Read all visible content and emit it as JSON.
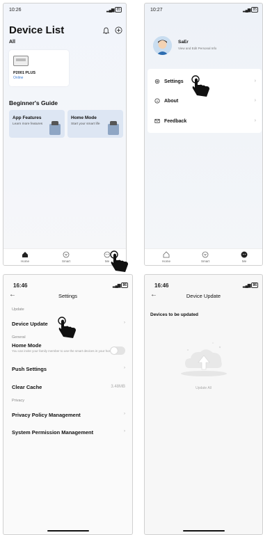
{
  "screen1": {
    "time": "10:26",
    "battery": "85",
    "title": "Device List",
    "subtitle": "All",
    "device": {
      "name": "P2001 PLUS",
      "status": "Online"
    },
    "guide_title": "Beginner's Guide",
    "guides": [
      {
        "title": "App Features",
        "subtitle": "Learn more features"
      },
      {
        "title": "Home Mode",
        "subtitle": "Start your smart life"
      }
    ],
    "tabs": [
      "Home",
      "Smart",
      "Me"
    ]
  },
  "screen2": {
    "time": "10:27",
    "battery": "85",
    "user_name": "SaEr",
    "user_info": "View and Edit Personal Info",
    "menu": [
      "Settings",
      "About",
      "Feedback"
    ],
    "tabs": [
      "Home",
      "Smart",
      "Me"
    ]
  },
  "screen3": {
    "time": "16:46",
    "battery": "86",
    "title": "Settings",
    "section_update": "Update",
    "device_update": "Device Update",
    "section_general": "General",
    "home_mode": "Home Mode",
    "home_mode_desc": "You can invite your family member to use the smart devices in your home.",
    "push_settings": "Push Settings",
    "clear_cache": "Clear Cache",
    "cache_size": "3.48MB",
    "section_privacy": "Privacy",
    "privacy_policy": "Privacy Policy Management",
    "system_permission": "System Permission Management"
  },
  "screen4": {
    "time": "16:46",
    "battery": "86",
    "title": "Device Update",
    "heading": "Devices to be updated",
    "update_all": "Update All"
  },
  "colors": {
    "accent": "#3a7bd5",
    "guide_card": "#dde6f3",
    "text": "#111111"
  },
  "icons": [
    "bell-icon",
    "add-icon",
    "home-icon",
    "smart-icon",
    "me-icon",
    "gear-icon",
    "info-icon",
    "mail-icon",
    "chevron-right-icon",
    "back-arrow-icon",
    "cloud-upload-icon",
    "tap-hand-icon"
  ]
}
